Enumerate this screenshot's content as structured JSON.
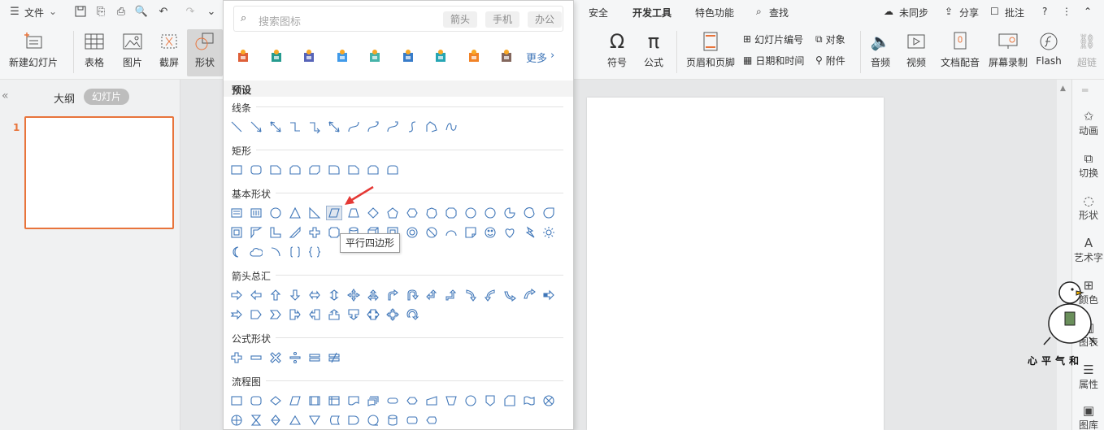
{
  "menubar": {
    "file_label": "文件",
    "tabs": [
      "安全",
      "开发工具",
      "特色功能"
    ],
    "search_label": "查找",
    "sync_label": "未同步",
    "share_label": "分享",
    "comment_label": "批注"
  },
  "ribbon": {
    "new_slide": "新建幻灯片",
    "table": "表格",
    "picture": "图片",
    "screenshot": "截屏",
    "shape": "形状",
    "symbol": "符号",
    "formula": "公式",
    "header_footer": "页眉和页脚",
    "slide_number": "幻灯片编号",
    "object": "对象",
    "datetime": "日期和时间",
    "attachment": "附件",
    "audio": "音频",
    "video": "视频",
    "doc_dub": "文档配音",
    "screen_record": "屏幕录制",
    "flash": "Flash",
    "hyperlink": "超链"
  },
  "leftpane": {
    "tab_outline": "大纲",
    "tab_slides": "幻灯片",
    "slide_number": "1"
  },
  "rightpanel": {
    "animation": "动画",
    "switch": "切换",
    "shape": "形状",
    "wordart": "艺术字",
    "color": "颜色",
    "chart": "图表",
    "property": "属性",
    "library": "图库"
  },
  "dropdown": {
    "search_placeholder": "搜索图标",
    "tags": [
      "箭头",
      "手机",
      "办公"
    ],
    "more_label": "更多",
    "preset_label": "预设",
    "sections": [
      "线条",
      "矩形",
      "基本形状",
      "箭头总汇",
      "公式形状",
      "流程图"
    ],
    "tooltip": "平行四边形"
  },
  "watermark_text": "心平气和",
  "colors": {
    "accent_orange": "#e8743b",
    "shape_stroke": "#3f76b8",
    "arrow_red": "#e53935"
  }
}
